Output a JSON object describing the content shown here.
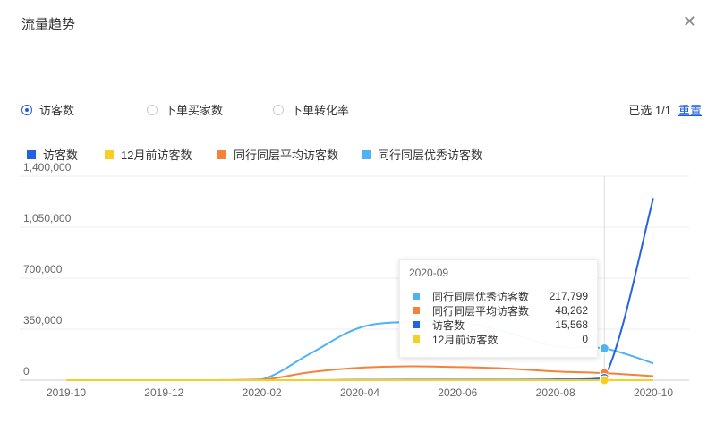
{
  "dialog": {
    "title": "流量趋势",
    "close_icon": "close-icon"
  },
  "metrics": {
    "options": [
      {
        "label": "访客数",
        "selected": true
      },
      {
        "label": "下单买家数",
        "selected": false
      },
      {
        "label": "下单转化率",
        "selected": false
      }
    ],
    "selected_info": "已选 1/1",
    "reset_label": "重置"
  },
  "legend": [
    {
      "label": "访客数",
      "color": "#2462e0"
    },
    {
      "label": "12月前访客数",
      "color": "#f5cf23"
    },
    {
      "label": "同行同层平均访客数",
      "color": "#f5813a"
    },
    {
      "label": "同行同层优秀访客数",
      "color": "#4fb2f4"
    }
  ],
  "chart_data": {
    "type": "line",
    "x_labels": [
      "2019-10",
      "2019-12",
      "2020-02",
      "2020-04",
      "2020-06",
      "2020-08",
      "2020-10"
    ],
    "x": [
      "2019-10",
      "2019-11",
      "2019-12",
      "2020-01",
      "2020-02",
      "2020-03",
      "2020-04",
      "2020-05",
      "2020-06",
      "2020-07",
      "2020-08",
      "2020-09",
      "2020-10"
    ],
    "ylim": [
      0,
      1400000
    ],
    "y_ticks": [
      "0",
      "350,000",
      "700,000",
      "1,050,000",
      "1,400,000"
    ],
    "series": [
      {
        "name": "同行同层优秀访客数",
        "color": "#4fb2f4",
        "values": [
          0,
          0,
          0,
          0,
          5000,
          185000,
          360000,
          400000,
          400000,
          330000,
          230000,
          217799,
          115000
        ]
      },
      {
        "name": "同行同层平均访客数",
        "color": "#f5813a",
        "values": [
          0,
          0,
          0,
          0,
          3000,
          55000,
          85000,
          95000,
          90000,
          80000,
          60000,
          48262,
          28000
        ]
      },
      {
        "name": "访客数",
        "color": "#2462e0",
        "values": [
          0,
          0,
          0,
          0,
          0,
          0,
          2000,
          3000,
          3000,
          3000,
          5000,
          15568,
          1250000
        ]
      },
      {
        "name": "12月前访客数",
        "color": "#f5cf23",
        "values": [
          0,
          0,
          0,
          0,
          0,
          0,
          0,
          0,
          0,
          0,
          0,
          0,
          0
        ]
      }
    ],
    "hover_x": "2020-09"
  },
  "tooltip": {
    "title": "2020-09",
    "rows": [
      {
        "label": "同行同层优秀访客数",
        "value": "217,799",
        "color": "#4fb2f4"
      },
      {
        "label": "同行同层平均访客数",
        "value": "48,262",
        "color": "#f5813a"
      },
      {
        "label": "访客数",
        "value": "15,568",
        "color": "#2462e0"
      },
      {
        "label": "12月前访客数",
        "value": "0",
        "color": "#f5cf23"
      }
    ]
  }
}
